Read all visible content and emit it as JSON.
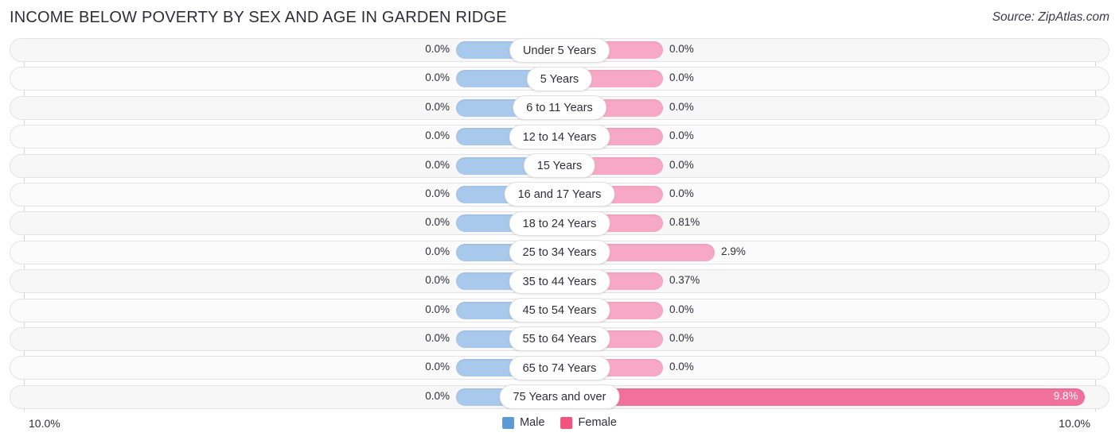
{
  "header": {
    "title": "Income Below Poverty by Sex and Age in Garden Ridge",
    "source": "Source: ZipAtlas.com"
  },
  "axis": {
    "left_label": "10.0%",
    "right_label": "10.0%",
    "max_percent": 10.0
  },
  "legend": {
    "male_label": "Male",
    "female_label": "Female",
    "male_color": "#5b9bd5",
    "female_color": "#f2537f"
  },
  "colors": {
    "male_bar": "#a8c8ec",
    "female_bar": "#f7a8c4",
    "female_bar_strong": "#f2709c",
    "track": "#f7f7f7",
    "gridline": "#d6d6d6"
  },
  "chart_data": {
    "type": "bar",
    "title": "Income Below Poverty by Sex and Age in Garden Ridge",
    "xlabel": "",
    "ylabel": "",
    "orientation": "horizontal-diverging",
    "xlim": [
      10.0,
      10.0
    ],
    "grid": true,
    "legend_position": "bottom-center",
    "categories": [
      "Under 5 Years",
      "5 Years",
      "6 to 11 Years",
      "12 to 14 Years",
      "15 Years",
      "16 and 17 Years",
      "18 to 24 Years",
      "25 to 34 Years",
      "35 to 44 Years",
      "45 to 54 Years",
      "55 to 64 Years",
      "65 to 74 Years",
      "75 Years and over"
    ],
    "series": [
      {
        "name": "Male",
        "values": [
          0.0,
          0.0,
          0.0,
          0.0,
          0.0,
          0.0,
          0.0,
          0.0,
          0.0,
          0.0,
          0.0,
          0.0,
          0.0
        ],
        "labels": [
          "0.0%",
          "0.0%",
          "0.0%",
          "0.0%",
          "0.0%",
          "0.0%",
          "0.0%",
          "0.0%",
          "0.0%",
          "0.0%",
          "0.0%",
          "0.0%",
          "0.0%"
        ]
      },
      {
        "name": "Female",
        "values": [
          0.0,
          0.0,
          0.0,
          0.0,
          0.0,
          0.0,
          0.81,
          2.9,
          0.37,
          0.0,
          0.0,
          0.0,
          9.8
        ],
        "labels": [
          "0.0%",
          "0.0%",
          "0.0%",
          "0.0%",
          "0.0%",
          "0.0%",
          "0.81%",
          "2.9%",
          "0.37%",
          "0.0%",
          "0.0%",
          "0.0%",
          "9.8%"
        ]
      }
    ]
  },
  "rows": [
    {
      "label": "Under 5 Years",
      "male": "0.0%",
      "female": "0.0%",
      "male_w": 0.0,
      "female_w": 0.0,
      "inside": false
    },
    {
      "label": "5 Years",
      "male": "0.0%",
      "female": "0.0%",
      "male_w": 0.0,
      "female_w": 0.0,
      "inside": false
    },
    {
      "label": "6 to 11 Years",
      "male": "0.0%",
      "female": "0.0%",
      "male_w": 0.0,
      "female_w": 0.0,
      "inside": false
    },
    {
      "label": "12 to 14 Years",
      "male": "0.0%",
      "female": "0.0%",
      "male_w": 0.0,
      "female_w": 0.0,
      "inside": false
    },
    {
      "label": "15 Years",
      "male": "0.0%",
      "female": "0.0%",
      "male_w": 0.0,
      "female_w": 0.0,
      "inside": false
    },
    {
      "label": "16 and 17 Years",
      "male": "0.0%",
      "female": "0.0%",
      "male_w": 0.0,
      "female_w": 0.0,
      "inside": false
    },
    {
      "label": "18 to 24 Years",
      "male": "0.0%",
      "female": "0.81%",
      "male_w": 0.0,
      "female_w": 0.81,
      "inside": false
    },
    {
      "label": "25 to 34 Years",
      "male": "0.0%",
      "female": "2.9%",
      "male_w": 0.0,
      "female_w": 2.9,
      "inside": false
    },
    {
      "label": "35 to 44 Years",
      "male": "0.0%",
      "female": "0.37%",
      "male_w": 0.0,
      "female_w": 0.37,
      "inside": false
    },
    {
      "label": "45 to 54 Years",
      "male": "0.0%",
      "female": "0.0%",
      "male_w": 0.0,
      "female_w": 0.0,
      "inside": false
    },
    {
      "label": "55 to 64 Years",
      "male": "0.0%",
      "female": "0.0%",
      "male_w": 0.0,
      "female_w": 0.0,
      "inside": false
    },
    {
      "label": "65 to 74 Years",
      "male": "0.0%",
      "female": "0.0%",
      "male_w": 0.0,
      "female_w": 0.0,
      "inside": false
    },
    {
      "label": "75 Years and over",
      "male": "0.0%",
      "female": "9.8%",
      "male_w": 0.0,
      "female_w": 9.8,
      "inside": true
    }
  ]
}
